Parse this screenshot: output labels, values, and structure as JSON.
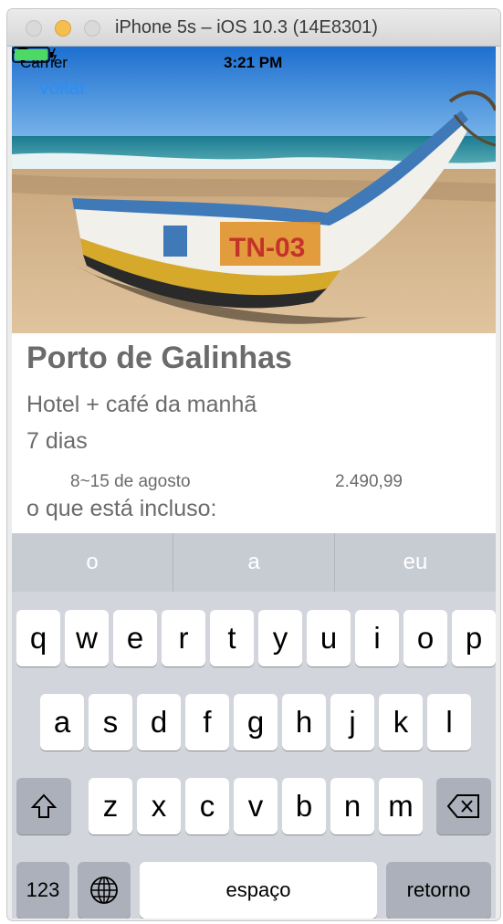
{
  "window": {
    "title": "iPhone 5s – iOS 10.3 (14E8301)"
  },
  "status_bar": {
    "carrier": "Carrier",
    "time": "3:21 PM",
    "battery_color": "#4cd964"
  },
  "nav": {
    "back_label": "voltar",
    "accent_color": "#2b8ef5"
  },
  "hero": {
    "boat_text": "TN-03"
  },
  "offer": {
    "title": "Porto de Galinhas",
    "subtitle": "Hotel + café da manhã",
    "duration": "7 dias",
    "dates": "8~15 de agosto",
    "price": "2.490,99",
    "included_label": "o que está incluso:"
  },
  "keyboard": {
    "suggestions": [
      "o",
      "a",
      "eu"
    ],
    "row1": [
      "q",
      "w",
      "e",
      "r",
      "t",
      "y",
      "u",
      "i",
      "o",
      "p"
    ],
    "row2": [
      "a",
      "s",
      "d",
      "f",
      "g",
      "h",
      "j",
      "k",
      "l"
    ],
    "row3": [
      "z",
      "x",
      "c",
      "v",
      "b",
      "n",
      "m"
    ],
    "numbers_label": "123",
    "space_label": "espaço",
    "return_label": "retorno",
    "icons": {
      "shift": "shift-icon",
      "backspace": "backspace-icon",
      "globe": "globe-icon"
    }
  }
}
